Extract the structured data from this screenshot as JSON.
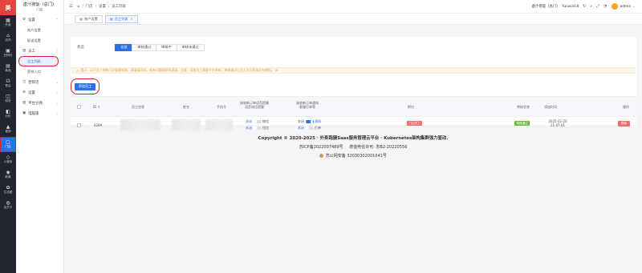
{
  "rail": {
    "logo": "美",
    "items": [
      {
        "icon": "grid-icon",
        "glyph": "▦",
        "label": "外卖"
      },
      {
        "icon": "shop-icon",
        "glyph": "⌂",
        "label": "店内"
      },
      {
        "icon": "qr-icon",
        "glyph": "▣",
        "label": "扫码付"
      },
      {
        "icon": "box-icon",
        "glyph": "▤",
        "label": "商品"
      },
      {
        "icon": "headset-icon",
        "glyph": "☊",
        "label": "售后"
      },
      {
        "icon": "wallet-icon",
        "glyph": "◫",
        "label": "财务"
      },
      {
        "icon": "chart-icon",
        "glyph": "◧",
        "label": "分析"
      },
      {
        "icon": "megaphone-icon",
        "glyph": "▲",
        "label": "营销"
      },
      {
        "icon": "store-icon",
        "glyph": "▢",
        "label": "门店"
      },
      {
        "icon": "miniapp-icon",
        "glyph": "◇",
        "label": "小程序"
      },
      {
        "icon": "newmedia-icon",
        "glyph": "◉",
        "label": "新媒"
      },
      {
        "icon": "ecosystem-icon",
        "glyph": "✿",
        "label": "生态圈"
      },
      {
        "icon": "members-icon",
        "glyph": "◍",
        "label": "会员卡"
      }
    ]
  },
  "sidebar": {
    "title": "虚汁捞饭（总门）",
    "subtitle": "门店",
    "groups": [
      {
        "icon": "gear-icon",
        "glyph": "⚙",
        "label": "设置",
        "chevron": "⌃"
      },
      {
        "sub": "账户设置"
      },
      {
        "sub": "配送设置"
      },
      {
        "icon": "clipboard-icon",
        "glyph": "▤",
        "label": "员工",
        "chevron": "⌃"
      },
      {
        "sub": "员工列表",
        "active": true
      },
      {
        "sub": "营销入口"
      },
      {
        "icon": "megaphone-icon",
        "glyph": "◫",
        "label": "营销活",
        "chevron": "⌄"
      },
      {
        "icon": "gear-icon",
        "glyph": "⚙",
        "label": "设置",
        "chevron": "⌄"
      },
      {
        "icon": "platform-icon",
        "glyph": "▥",
        "label": "平台分佣",
        "chevron": "⌄"
      },
      {
        "icon": "book-icon",
        "glyph": "▣",
        "label": "电脑版",
        "chevron": "⌄"
      }
    ]
  },
  "topbar": {
    "breadcrumb": [
      "门店",
      "设置",
      "员工列表"
    ],
    "store": "虚汁捞饭（总门）",
    "store_id": "funacid.8",
    "user": "admin"
  },
  "tabs": [
    {
      "label": "账户设置",
      "active": false
    },
    {
      "label": "员工列表",
      "active": true
    }
  ],
  "filter": {
    "label": "状态",
    "options": [
      "全部",
      "审核通过",
      "审核中",
      "审核未通过"
    ],
    "selected": "全部"
  },
  "notice": "提示：以下员工拥有门店管理权限，请谨慎添加，若有问题请联系客服。注意：添加员工需要平台审核，审核通过后员工方可登录后台使用。 ☒",
  "add_button": "添加员工",
  "table": {
    "headers": {
      "id": "ID ↕",
      "info": "员工信息",
      "name": "姓名",
      "phone": "手机号",
      "perm_a": [
        "接收新订单语音提醒",
        "语音电话提醒"
      ],
      "perm_b": [
        "接收新订单通知",
        "客服打单等"
      ],
      "role": "职位",
      "status": "审核状态",
      "added": "添加时间",
      "action": "操作"
    },
    "rows": [
      {
        "id": "6289",
        "toggle_a": [
          {
            "left": "关闭",
            "right": "微信",
            "on": false
          },
          {
            "left": "关闭",
            "right": "短信",
            "on": false
          }
        ],
        "toggle_b": [
          {
            "left": "关闭",
            "right": "通知",
            "on": true
          },
          {
            "left": "关闭",
            "right": "打单",
            "on": false
          }
        ],
        "role": "门店员工",
        "status": "审核通过",
        "added": "2025-02-26 21:07:01",
        "action": "删除"
      }
    ]
  },
  "footer": {
    "copyright": "Copyright © 2020-2025 · 外卖跑腿Saas服务管理云平台 · Kubernetes架构集群强力驱动.",
    "icp": "苏ICP备2022007489号",
    "license_label": "增值电信许可:",
    "license": "苏B2-20220556",
    "security": "苏公网安备 32030302001041号"
  },
  "colors": {
    "rail": "#22252d",
    "accent": "#2f6fe4",
    "danger": "#f56c6c",
    "success": "#67c23a",
    "highlight": "#e02020"
  }
}
